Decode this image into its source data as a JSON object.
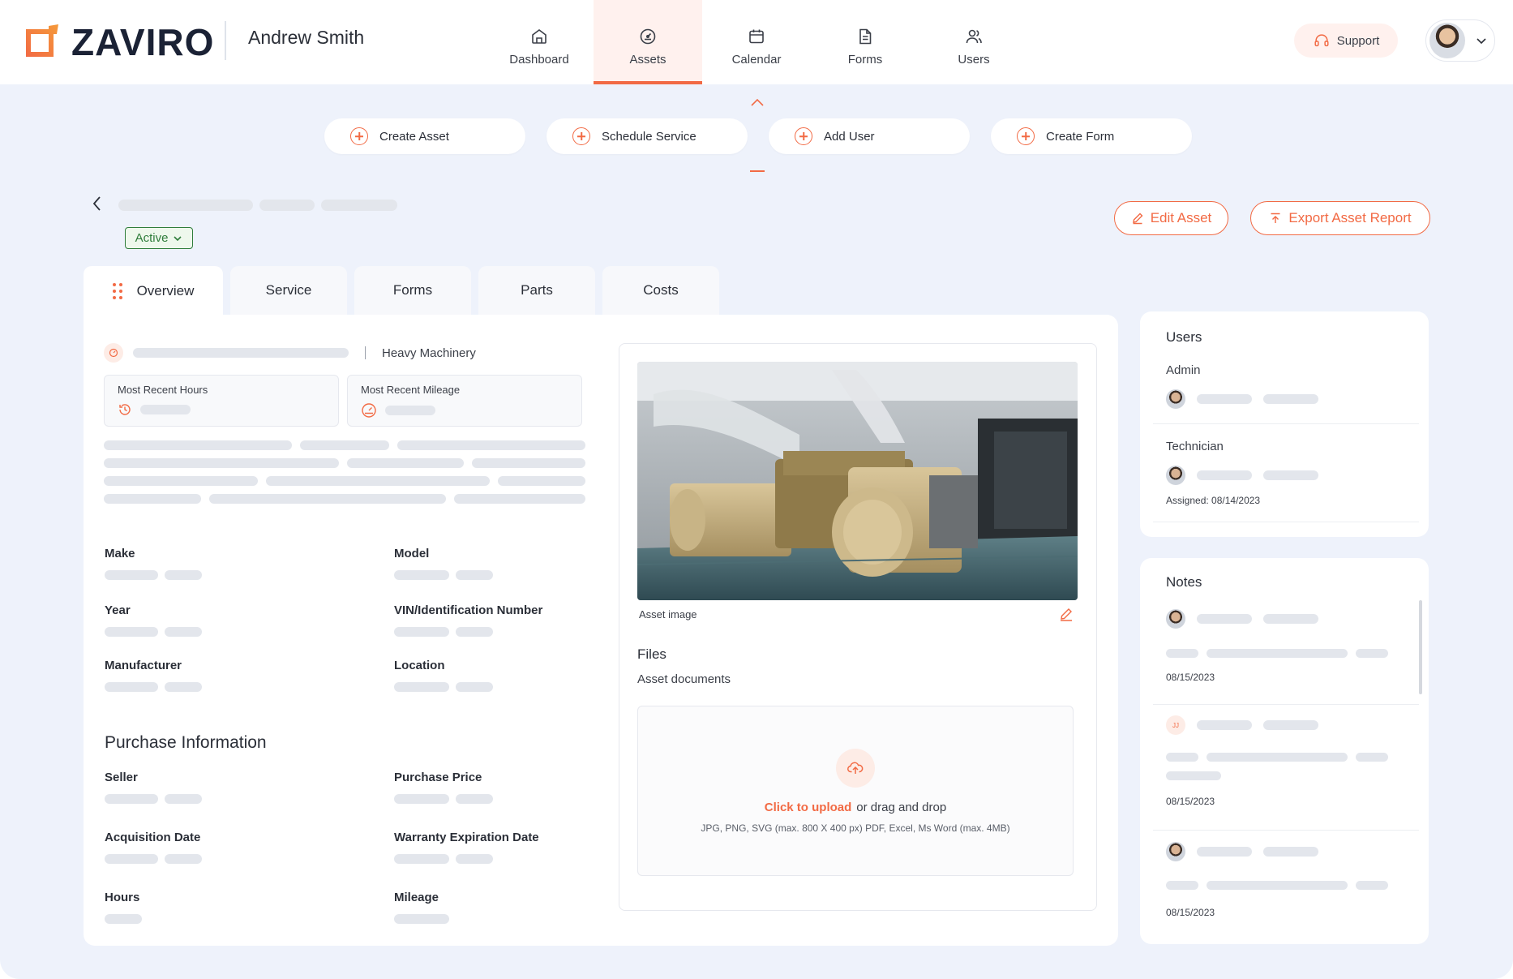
{
  "header": {
    "brand": "ZAVIRO",
    "user_name": "Andrew Smith",
    "nav": [
      {
        "label": "Dashboard",
        "icon": "home-icon",
        "active": false
      },
      {
        "label": "Assets",
        "icon": "gauge-icon",
        "active": true
      },
      {
        "label": "Calendar",
        "icon": "calendar-icon",
        "active": false
      },
      {
        "label": "Forms",
        "icon": "document-icon",
        "active": false
      },
      {
        "label": "Users",
        "icon": "users-icon",
        "active": false
      }
    ],
    "support_label": "Support"
  },
  "quick_actions": [
    "Create Asset",
    "Schedule Service",
    "Add User",
    "Create Form"
  ],
  "asset": {
    "status": "Active",
    "edit_label": "Edit Asset",
    "export_label": "Export Asset Report",
    "category": "Heavy Machinery"
  },
  "tabs": [
    "Overview",
    "Service",
    "Forms",
    "Parts",
    "Costs"
  ],
  "metrics": {
    "hours_label": "Most Recent Hours",
    "mileage_label": "Most Recent Mileage"
  },
  "details": {
    "make": "Make",
    "model": "Model",
    "year": "Year",
    "vin": "VIN/Identification Number",
    "manufacturer": "Manufacturer",
    "location": "Location"
  },
  "purchase": {
    "title": "Purchase Information",
    "seller": "Seller",
    "price": "Purchase Price",
    "acq_date": "Acquisition Date",
    "warranty": "Warranty Expiration Date",
    "hours": "Hours",
    "mileage": "Mileage"
  },
  "media": {
    "caption": "Asset image",
    "files_title": "Files",
    "files_sub": "Asset documents",
    "upload_link": "Click to upload",
    "upload_rest": "or drag and drop",
    "upload_hint": "JPG, PNG, SVG (max. 800 X 400 px) PDF, Excel, Ms Word (max. 4MB)"
  },
  "users_panel": {
    "title": "Users",
    "admin_label": "Admin",
    "tech_label": "Technician",
    "assigned": "Assigned: 08/14/2023"
  },
  "notes_panel": {
    "title": "Notes",
    "initials": "JJ",
    "dates": [
      "08/15/2023",
      "08/15/2023",
      "08/15/2023"
    ]
  },
  "colors": {
    "accent": "#f26a44",
    "status_green": "#2f7d3b",
    "background": "#eef2fb"
  }
}
